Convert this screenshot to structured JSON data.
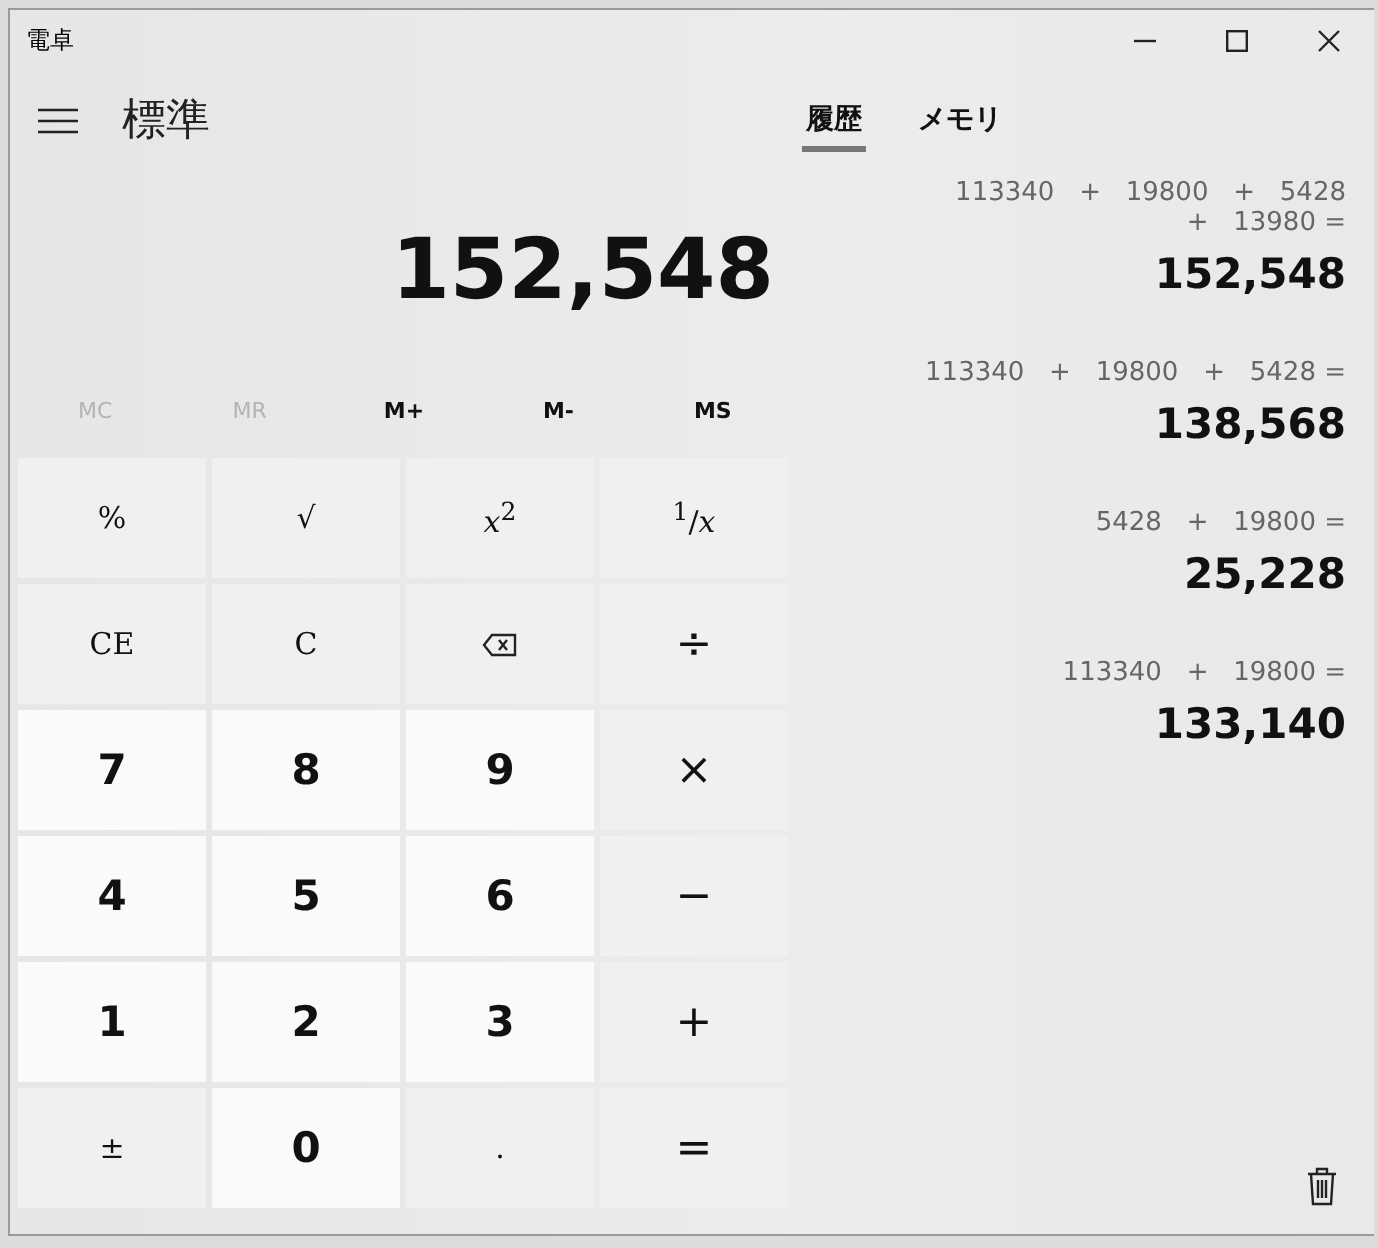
{
  "window": {
    "title": "電卓"
  },
  "header": {
    "mode": "標準"
  },
  "tabs": [
    {
      "label": "履歴",
      "selected": true
    },
    {
      "label": "メモリ",
      "selected": false
    }
  ],
  "display": {
    "value": "152,548"
  },
  "memory_buttons": [
    {
      "label": "MC",
      "disabled": true
    },
    {
      "label": "MR",
      "disabled": true
    },
    {
      "label": "M+",
      "disabled": false
    },
    {
      "label": "M-",
      "disabled": false
    },
    {
      "label": "MS",
      "disabled": false
    }
  ],
  "keys": [
    {
      "kind": "function",
      "label": "%"
    },
    {
      "kind": "function",
      "label": "√"
    },
    {
      "kind": "function",
      "label": "*x*$^{2}$"
    },
    {
      "kind": "function",
      "label": "$^{1}$/*x*"
    },
    {
      "kind": "function",
      "label": "CE"
    },
    {
      "kind": "function",
      "label": "C"
    },
    {
      "kind": "backspace"
    },
    {
      "kind": "operator",
      "label": "÷"
    },
    {
      "kind": "number",
      "label": "7"
    },
    {
      "kind": "number",
      "label": "8"
    },
    {
      "kind": "number",
      "label": "9"
    },
    {
      "kind": "operator",
      "label": "×"
    },
    {
      "kind": "number",
      "label": "4"
    },
    {
      "kind": "number",
      "label": "5"
    },
    {
      "kind": "number",
      "label": "6"
    },
    {
      "kind": "operator",
      "label": "−"
    },
    {
      "kind": "number",
      "label": "1"
    },
    {
      "kind": "number",
      "label": "2"
    },
    {
      "kind": "number",
      "label": "3"
    },
    {
      "kind": "operator",
      "label": "+"
    },
    {
      "kind": "function",
      "label": "±"
    },
    {
      "kind": "number",
      "label": "0"
    },
    {
      "kind": "function",
      "label": "."
    },
    {
      "kind": "operator",
      "label": "="
    }
  ],
  "history": [
    {
      "expression": "113340   +   19800   +   5428   +   13980 =",
      "result": "152,548"
    },
    {
      "expression": "113340   +   19800   +   5428 =",
      "result": "138,568"
    },
    {
      "expression": "5428   +   19800 =",
      "result": "25,228"
    },
    {
      "expression": "113340   +   19800 =",
      "result": "133,140"
    }
  ]
}
